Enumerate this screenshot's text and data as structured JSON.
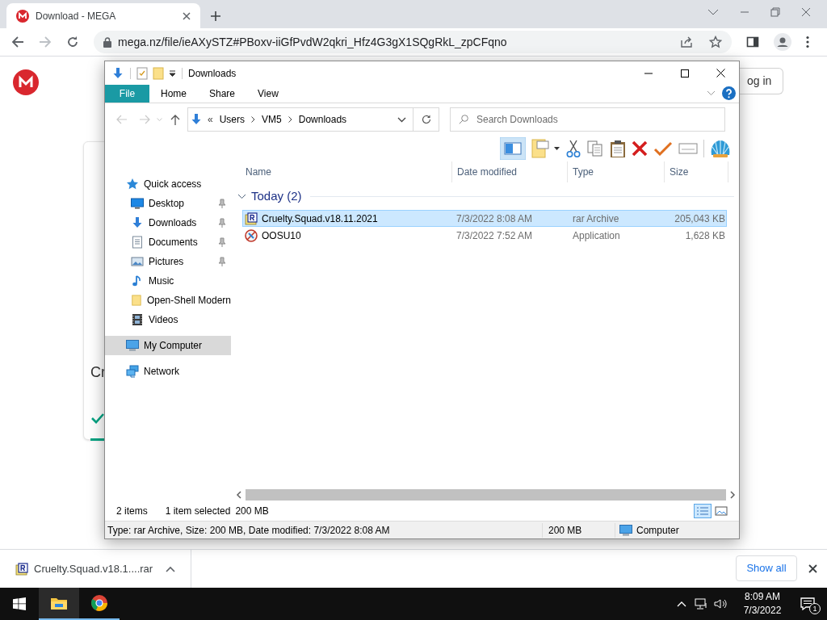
{
  "browser": {
    "tab_title": "Download - MEGA",
    "url": "mega.nz/file/ieAXySTZ#PBoxv-iiGfPvdW2qkri_Hfz4G3gX1SQgRkL_zpCFqno"
  },
  "page": {
    "login_button": "og in",
    "card_title": "Cr"
  },
  "explorer": {
    "title": "Downloads",
    "ribbon_tabs": [
      {
        "label": "File",
        "selected": true
      },
      {
        "label": "Home",
        "selected": false
      },
      {
        "label": "Share",
        "selected": false
      },
      {
        "label": "View",
        "selected": false
      }
    ],
    "breadcrumb_overflow": "«",
    "breadcrumb": [
      "Users",
      "VM5",
      "Downloads"
    ],
    "search": {
      "placeholder": "Search Downloads"
    },
    "nav": [
      {
        "label": "Quick access",
        "kind": "star",
        "selected": false,
        "children": [
          {
            "label": "Desktop",
            "kind": "desktop",
            "pinned": true,
            "selected": false
          },
          {
            "label": "Downloads",
            "kind": "download",
            "pinned": true,
            "selected": false
          },
          {
            "label": "Documents",
            "kind": "documents",
            "pinned": true,
            "selected": false
          },
          {
            "label": "Pictures",
            "kind": "pictures",
            "pinned": true,
            "selected": false
          },
          {
            "label": "Music",
            "kind": "music",
            "pinned": false,
            "selected": false
          },
          {
            "label": "Open-Shell Modern",
            "kind": "folder",
            "pinned": false,
            "selected": false
          },
          {
            "label": "Videos",
            "kind": "videos",
            "pinned": false,
            "selected": false
          }
        ]
      },
      {
        "label": "My Computer",
        "kind": "computer",
        "selected": true
      },
      {
        "label": "Network",
        "kind": "network",
        "selected": false
      }
    ],
    "columns": [
      "Name",
      "Date modified",
      "Type",
      "Size"
    ],
    "group": {
      "label": "Today (2)",
      "expanded": true
    },
    "files": [
      {
        "kind": "rar",
        "name": "Cruelty.Squad.v18.11.2021",
        "date": "7/3/2022 8:08 AM",
        "type": "rar Archive",
        "size": "205,043 KB",
        "selected": true
      },
      {
        "kind": "app",
        "name": "OOSU10",
        "date": "7/3/2022 7:52 AM",
        "type": "Application",
        "size": "1,628 KB",
        "selected": false
      }
    ],
    "status": {
      "items": "2 items",
      "selection": "1 item selected",
      "size": "200 MB"
    },
    "details_bar": {
      "info": "Type: rar Archive, Size: 200 MB, Date modified: 7/3/2022 8:08 AM",
      "size": "200 MB",
      "location": "Computer"
    }
  },
  "download_shelf": {
    "file": "Cruelty.Squad.v18.1....rar",
    "show_all": "Show all"
  },
  "taskbar": {
    "time": "8:09 AM",
    "date": "7/3/2022",
    "notification_count": "1"
  }
}
